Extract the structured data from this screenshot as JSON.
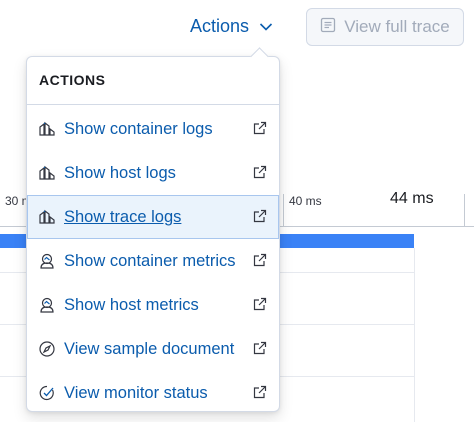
{
  "header": {
    "actions_label": "Actions",
    "view_full_trace_label": "View full trace"
  },
  "timeline": {
    "tick_left": "30 m",
    "tick_mid": "40 ms",
    "tick_end": "44 ms"
  },
  "popover": {
    "title": "ACTIONS",
    "items": [
      {
        "label": "Show container logs",
        "icon": "logs-app-icon"
      },
      {
        "label": "Show host logs",
        "icon": "logs-app-icon"
      },
      {
        "label": "Show trace logs",
        "icon": "logs-app-icon",
        "highlighted": true
      },
      {
        "label": "Show container metrics",
        "icon": "metrics-app-icon"
      },
      {
        "label": "Show host metrics",
        "icon": "metrics-app-icon"
      },
      {
        "label": "View sample document",
        "icon": "compass-icon"
      },
      {
        "label": "View monitor status",
        "icon": "uptime-app-icon"
      }
    ]
  },
  "colors": {
    "link": "#0b5cad",
    "span_bar": "#3a82f6",
    "highlight_bg": "#eaf3fc"
  }
}
